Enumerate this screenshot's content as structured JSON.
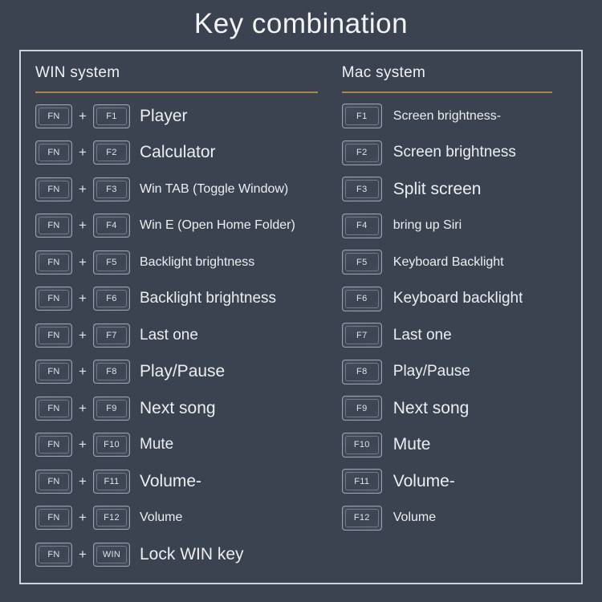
{
  "title": "Key combination",
  "colors": {
    "background": "#3b4250",
    "panel_border": "#cfd3da",
    "divider": "#a9884f",
    "text": "#eceef2"
  },
  "win": {
    "heading": "WIN system",
    "modifier_key": "FN",
    "plus": "+",
    "rows": [
      {
        "key": "F1",
        "label": "Player",
        "size": "fs-xl"
      },
      {
        "key": "F2",
        "label": "Calculator",
        "size": "fs-xl"
      },
      {
        "key": "F3",
        "label": "Win TAB (Toggle Window)",
        "size": "fs-md"
      },
      {
        "key": "F4",
        "label": "Win E (Open Home Folder)",
        "size": "fs-md"
      },
      {
        "key": "F5",
        "label": "Backlight brightness",
        "size": "fs-md"
      },
      {
        "key": "F6",
        "label": "Backlight brightness",
        "size": "fs-lg"
      },
      {
        "key": "F7",
        "label": "Last one",
        "size": "fs-lg"
      },
      {
        "key": "F8",
        "label": "Play/Pause",
        "size": "fs-xl"
      },
      {
        "key": "F9",
        "label": "Next song",
        "size": "fs-xl"
      },
      {
        "key": "F10",
        "label": "Mute",
        "size": "fs-lg"
      },
      {
        "key": "F11",
        "label": "Volume-",
        "size": "fs-xl"
      },
      {
        "key": "F12",
        "label": "Volume",
        "size": "fs-md"
      },
      {
        "key": "WIN",
        "label": "Lock WIN key",
        "size": "fs-xl"
      }
    ]
  },
  "mac": {
    "heading": "Mac system",
    "rows": [
      {
        "key": "F1",
        "label": "Screen brightness-",
        "size": "fs-md"
      },
      {
        "key": "F2",
        "label": "Screen brightness",
        "size": "fs-lg"
      },
      {
        "key": "F3",
        "label": "Split screen",
        "size": "fs-xl"
      },
      {
        "key": "F4",
        "label": "bring up Siri",
        "size": "fs-md"
      },
      {
        "key": "F5",
        "label": "Keyboard Backlight",
        "size": "fs-md"
      },
      {
        "key": "F6",
        "label": "Keyboard backlight",
        "size": "fs-lg"
      },
      {
        "key": "F7",
        "label": "Last one",
        "size": "fs-lg"
      },
      {
        "key": "F8",
        "label": "Play/Pause",
        "size": "fs-lg"
      },
      {
        "key": "F9",
        "label": "Next song",
        "size": "fs-xl"
      },
      {
        "key": "F10",
        "label": "Mute",
        "size": "fs-xl"
      },
      {
        "key": "F11",
        "label": "Volume-",
        "size": "fs-xl"
      },
      {
        "key": "F12",
        "label": "Volume",
        "size": "fs-md"
      }
    ]
  }
}
